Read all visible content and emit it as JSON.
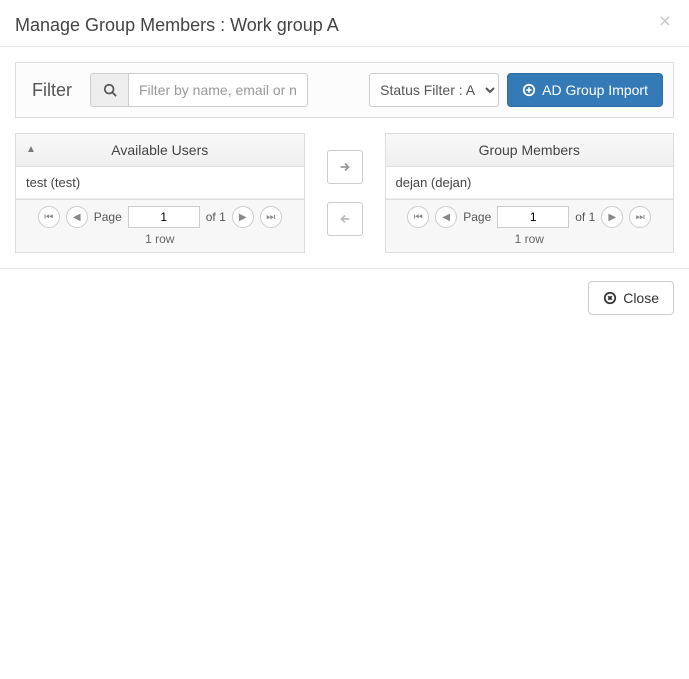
{
  "header": {
    "title": "Manage Group Members : Work group A"
  },
  "filter": {
    "label": "Filter",
    "placeholder": "Filter by name, email or no",
    "status_selected": "Status Filter : All",
    "import_button": "AD Group Import"
  },
  "available": {
    "title": "Available Users",
    "rows": [
      "test (test)"
    ],
    "page_label": "Page",
    "page_current": "1",
    "page_total": "of 1",
    "row_count": "1 row"
  },
  "members": {
    "title": "Group Members",
    "rows": [
      "dejan (dejan)"
    ],
    "page_label": "Page",
    "page_current": "1",
    "page_total": "of 1",
    "row_count": "1 row"
  },
  "footer": {
    "close": "Close"
  }
}
